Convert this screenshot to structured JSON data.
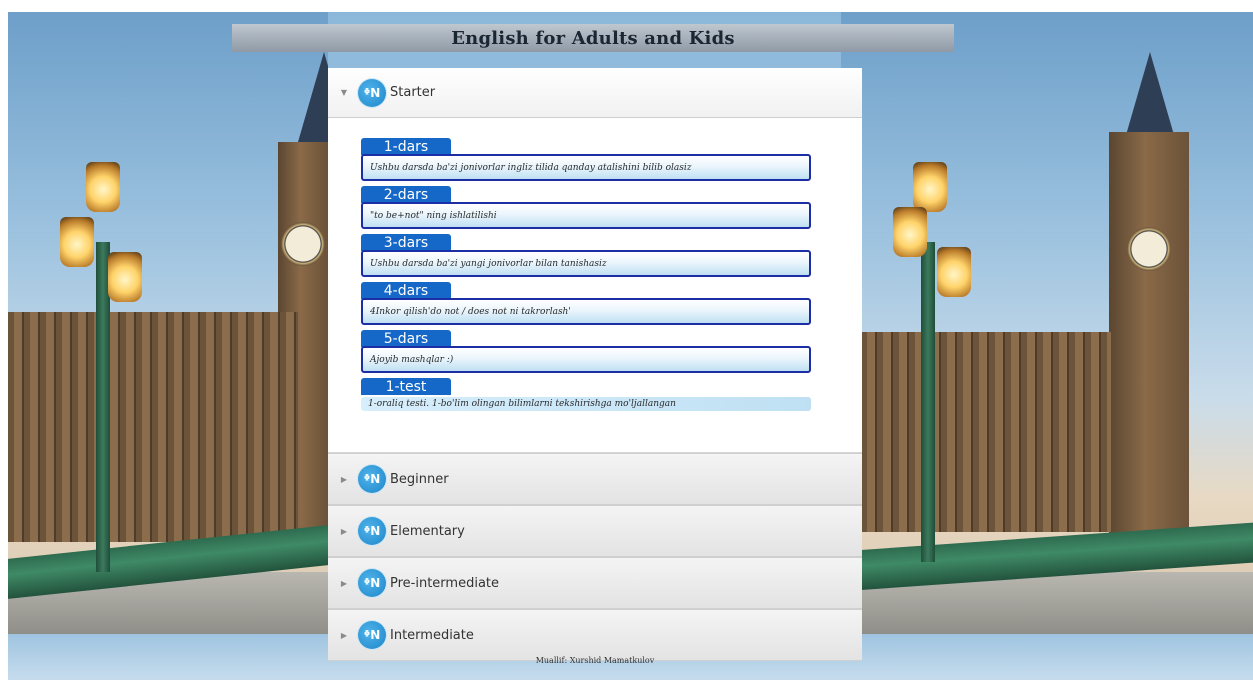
{
  "header": {
    "title": "English for Adults and Kids"
  },
  "sections": [
    {
      "label": "Starter",
      "expanded": true,
      "lessons": [
        {
          "tab": "1-dars",
          "description": "Ushbu darsda ba'zi jonivorlar ingliz tilida qanday atalishini bilib olasiz"
        },
        {
          "tab": "2-dars",
          "description": "\"to be+not\" ning ishlatilishi"
        },
        {
          "tab": "3-dars",
          "description": "Ushbu darsda ba'zi yangi jonivorlar bilan tanishasiz"
        },
        {
          "tab": "4-dars",
          "description": "4Inkor qilish'do not / does not ni takrorlash'"
        },
        {
          "tab": "5-dars",
          "description": "Ajoyib mashqlar :)"
        },
        {
          "tab": "1-test",
          "description": "1-oraliq testi. 1-bo'lim olingan bilimlarni tekshirishga mo'ljallangan"
        }
      ]
    },
    {
      "label": "Beginner",
      "expanded": false
    },
    {
      "label": "Elementary",
      "expanded": false
    },
    {
      "label": "Pre-intermediate",
      "expanded": false
    },
    {
      "label": "Intermediate",
      "expanded": false
    }
  ],
  "icons": {
    "expanded_arrow": "▼",
    "collapsed_arrow": "▶",
    "logo": "ᶲN"
  },
  "footer": {
    "text": "Muallif: Xurshid Mamatkulov"
  },
  "colors": {
    "accent": "#1568c8",
    "border": "#1b2ea5",
    "logo": "#1e86c9"
  }
}
